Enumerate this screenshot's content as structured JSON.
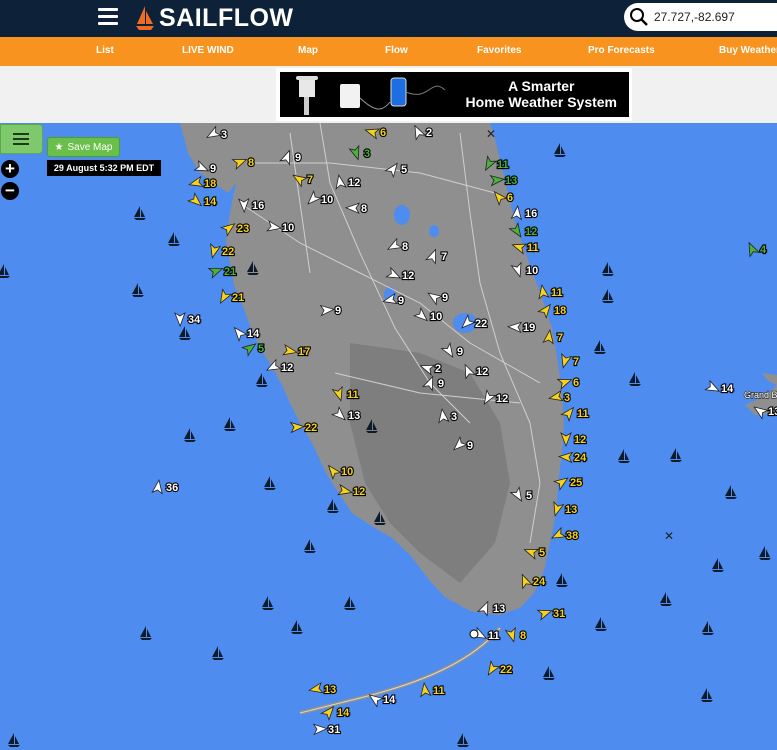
{
  "app": {
    "name": "SAILFLOW"
  },
  "search": {
    "value": "27.727,-82.697"
  },
  "nav": {
    "items": [
      {
        "label": "List"
      },
      {
        "label": "LIVE WIND"
      },
      {
        "label": "Map"
      },
      {
        "label": "Flow"
      },
      {
        "label": "Favorites"
      },
      {
        "label": "Pro Forecasts"
      },
      {
        "label": "Buy Weather"
      }
    ]
  },
  "ad": {
    "headline_1": "A Smarter",
    "headline_2": "Home Weather System"
  },
  "map": {
    "save_label": "Save Map",
    "timestamp": "29 August 5:32 PM EDT",
    "zoom_in": "+",
    "zoom_out": "−",
    "town_label": "Grand Ba",
    "colors": {
      "water": "#4f8cf0",
      "land": "#8f8f8f",
      "calm": "#ffffff",
      "moderate": "#f7d21c",
      "strong": "#49b23a",
      "nav": "#f7931e",
      "header": "#0d2238"
    },
    "stations": [
      {
        "s": "3",
        "c": "w"
      },
      {
        "s": "6",
        "c": "y"
      },
      {
        "s": "2",
        "c": "w"
      },
      {
        "s": "9",
        "c": "w"
      },
      {
        "s": "8",
        "c": "y"
      },
      {
        "s": "9",
        "c": "w"
      },
      {
        "s": "3",
        "c": "g"
      },
      {
        "s": "11",
        "c": "g"
      },
      {
        "s": "18",
        "c": "y"
      },
      {
        "s": "7",
        "c": "y"
      },
      {
        "s": "12",
        "c": "w"
      },
      {
        "s": "5",
        "c": "w"
      },
      {
        "s": "13",
        "c": "g"
      },
      {
        "s": "14",
        "c": "y"
      },
      {
        "s": "16",
        "c": "w"
      },
      {
        "s": "10",
        "c": "w"
      },
      {
        "s": "8",
        "c": "w"
      },
      {
        "s": "6",
        "c": "y"
      },
      {
        "s": "16",
        "c": "w"
      },
      {
        "s": "23",
        "c": "y"
      },
      {
        "s": "10",
        "c": "w"
      },
      {
        "s": "12",
        "c": "g"
      },
      {
        "s": "22",
        "c": "y"
      },
      {
        "s": "8",
        "c": "w"
      },
      {
        "s": "11",
        "c": "y"
      },
      {
        "s": "4",
        "c": "g"
      },
      {
        "s": "7",
        "c": "w"
      },
      {
        "s": "21",
        "c": "g"
      },
      {
        "s": "12",
        "c": "w"
      },
      {
        "s": "10",
        "c": "w"
      },
      {
        "s": "21",
        "c": "y"
      },
      {
        "s": "9",
        "c": "w"
      },
      {
        "s": "9",
        "c": "w"
      },
      {
        "s": "11",
        "c": "y"
      },
      {
        "s": "18",
        "c": "y"
      },
      {
        "s": "9",
        "c": "w"
      },
      {
        "s": "10",
        "c": "w"
      },
      {
        "s": "34",
        "c": "w"
      },
      {
        "s": "22",
        "c": "w"
      },
      {
        "s": "19",
        "c": "w"
      },
      {
        "s": "14",
        "c": "w"
      },
      {
        "s": "7",
        "c": "y"
      },
      {
        "s": "5",
        "c": "g"
      },
      {
        "s": "17",
        "c": "y"
      },
      {
        "s": "9",
        "c": "w"
      },
      {
        "s": "7",
        "c": "y"
      },
      {
        "s": "12",
        "c": "w"
      },
      {
        "s": "2",
        "c": "w"
      },
      {
        "s": "12",
        "c": "w"
      },
      {
        "s": "9",
        "c": "w"
      },
      {
        "s": "6",
        "c": "y"
      },
      {
        "s": "14",
        "c": "w"
      },
      {
        "s": "11",
        "c": "y"
      },
      {
        "s": "12",
        "c": "w"
      },
      {
        "s": "3",
        "c": "y"
      },
      {
        "s": "13",
        "c": "w"
      },
      {
        "s": "3",
        "c": "w"
      },
      {
        "s": "11",
        "c": "y"
      },
      {
        "s": "22",
        "c": "y"
      },
      {
        "s": "13",
        "c": "w"
      },
      {
        "s": "12",
        "c": "y"
      },
      {
        "s": "9",
        "c": "w"
      },
      {
        "s": "24",
        "c": "y"
      },
      {
        "s": "10",
        "c": "y"
      },
      {
        "s": "36",
        "c": "w"
      },
      {
        "s": "25",
        "c": "y"
      },
      {
        "s": "12",
        "c": "y"
      },
      {
        "s": "5",
        "c": "w"
      },
      {
        "s": "13",
        "c": "y"
      },
      {
        "s": "38",
        "c": "y"
      },
      {
        "s": "5",
        "c": "y"
      },
      {
        "s": "24",
        "c": "y"
      },
      {
        "s": "13",
        "c": "w"
      },
      {
        "s": "31",
        "c": "y"
      },
      {
        "s": "11",
        "c": "w"
      },
      {
        "s": "8",
        "c": "y"
      },
      {
        "s": "22",
        "c": "y"
      },
      {
        "s": "13",
        "c": "y"
      },
      {
        "s": "14",
        "c": "w"
      },
      {
        "s": "11",
        "c": "y"
      },
      {
        "s": "14",
        "c": "y"
      },
      {
        "s": "31",
        "c": "w"
      }
    ]
  }
}
